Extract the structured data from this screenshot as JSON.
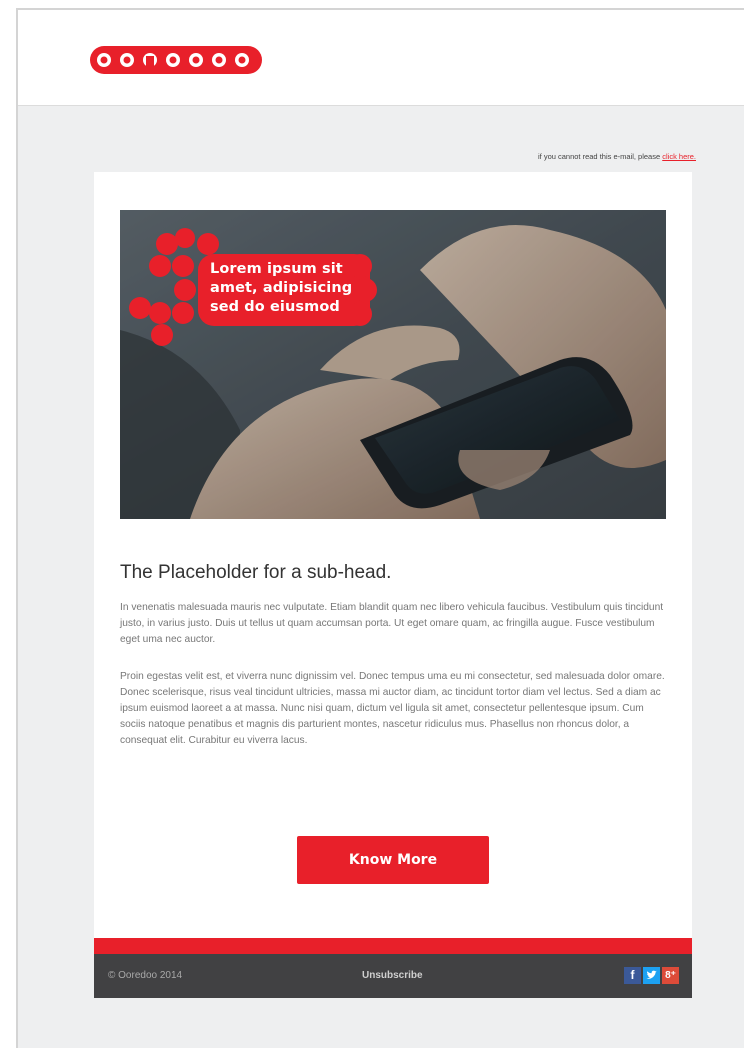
{
  "brand": {
    "logo_text": "ooredoo",
    "accent_color": "#e8202a"
  },
  "preheader": {
    "text": "if you cannot read this e-mail, please",
    "link_label": "click here."
  },
  "hero": {
    "overlay_line1": "Lorem ipsum  sit",
    "overlay_line2": "amet, adipisicing",
    "overlay_line3": "sed do eiusmod"
  },
  "content": {
    "subhead": "The Placeholder for a sub-head.",
    "paragraph1": "In venenatis malesuada mauris nec vulputate. Etiam blandit quam nec libero vehicula faucibus. Vestibulum quis tincidunt justo, in varius justo. Duis ut tellus ut quam accumsan porta. Ut eget omare quam, ac fringilla augue. Fusce vestibulum eget uma nec auctor.",
    "paragraph2": "Proin egestas velit est, et viverra nunc dignissim vel. Donec tempus uma eu mi consectetur, sed malesuada dolor omare. Donec scelerisque, risus veal tincidunt ultricies, massa mi auctor diam, ac tincidunt tortor diam vel lectus. Sed a diam ac ipsum euismod laoreet a at massa. Nunc nisi quam, dictum vel ligula sit amet, consectetur pellentesque ipsum. Cum sociis natoque penatibus et magnis dis parturient montes, nascetur ridiculus mus. Phasellus non rhoncus dolor, a consequat elit. Curabitur eu viverra lacus.",
    "cta_label": "Know More"
  },
  "footer": {
    "copyright": "© Ooredoo 2014",
    "unsubscribe": "Unsubscribe",
    "social": {
      "facebook": "f",
      "twitter": "t",
      "googleplus": "8⁺"
    }
  }
}
